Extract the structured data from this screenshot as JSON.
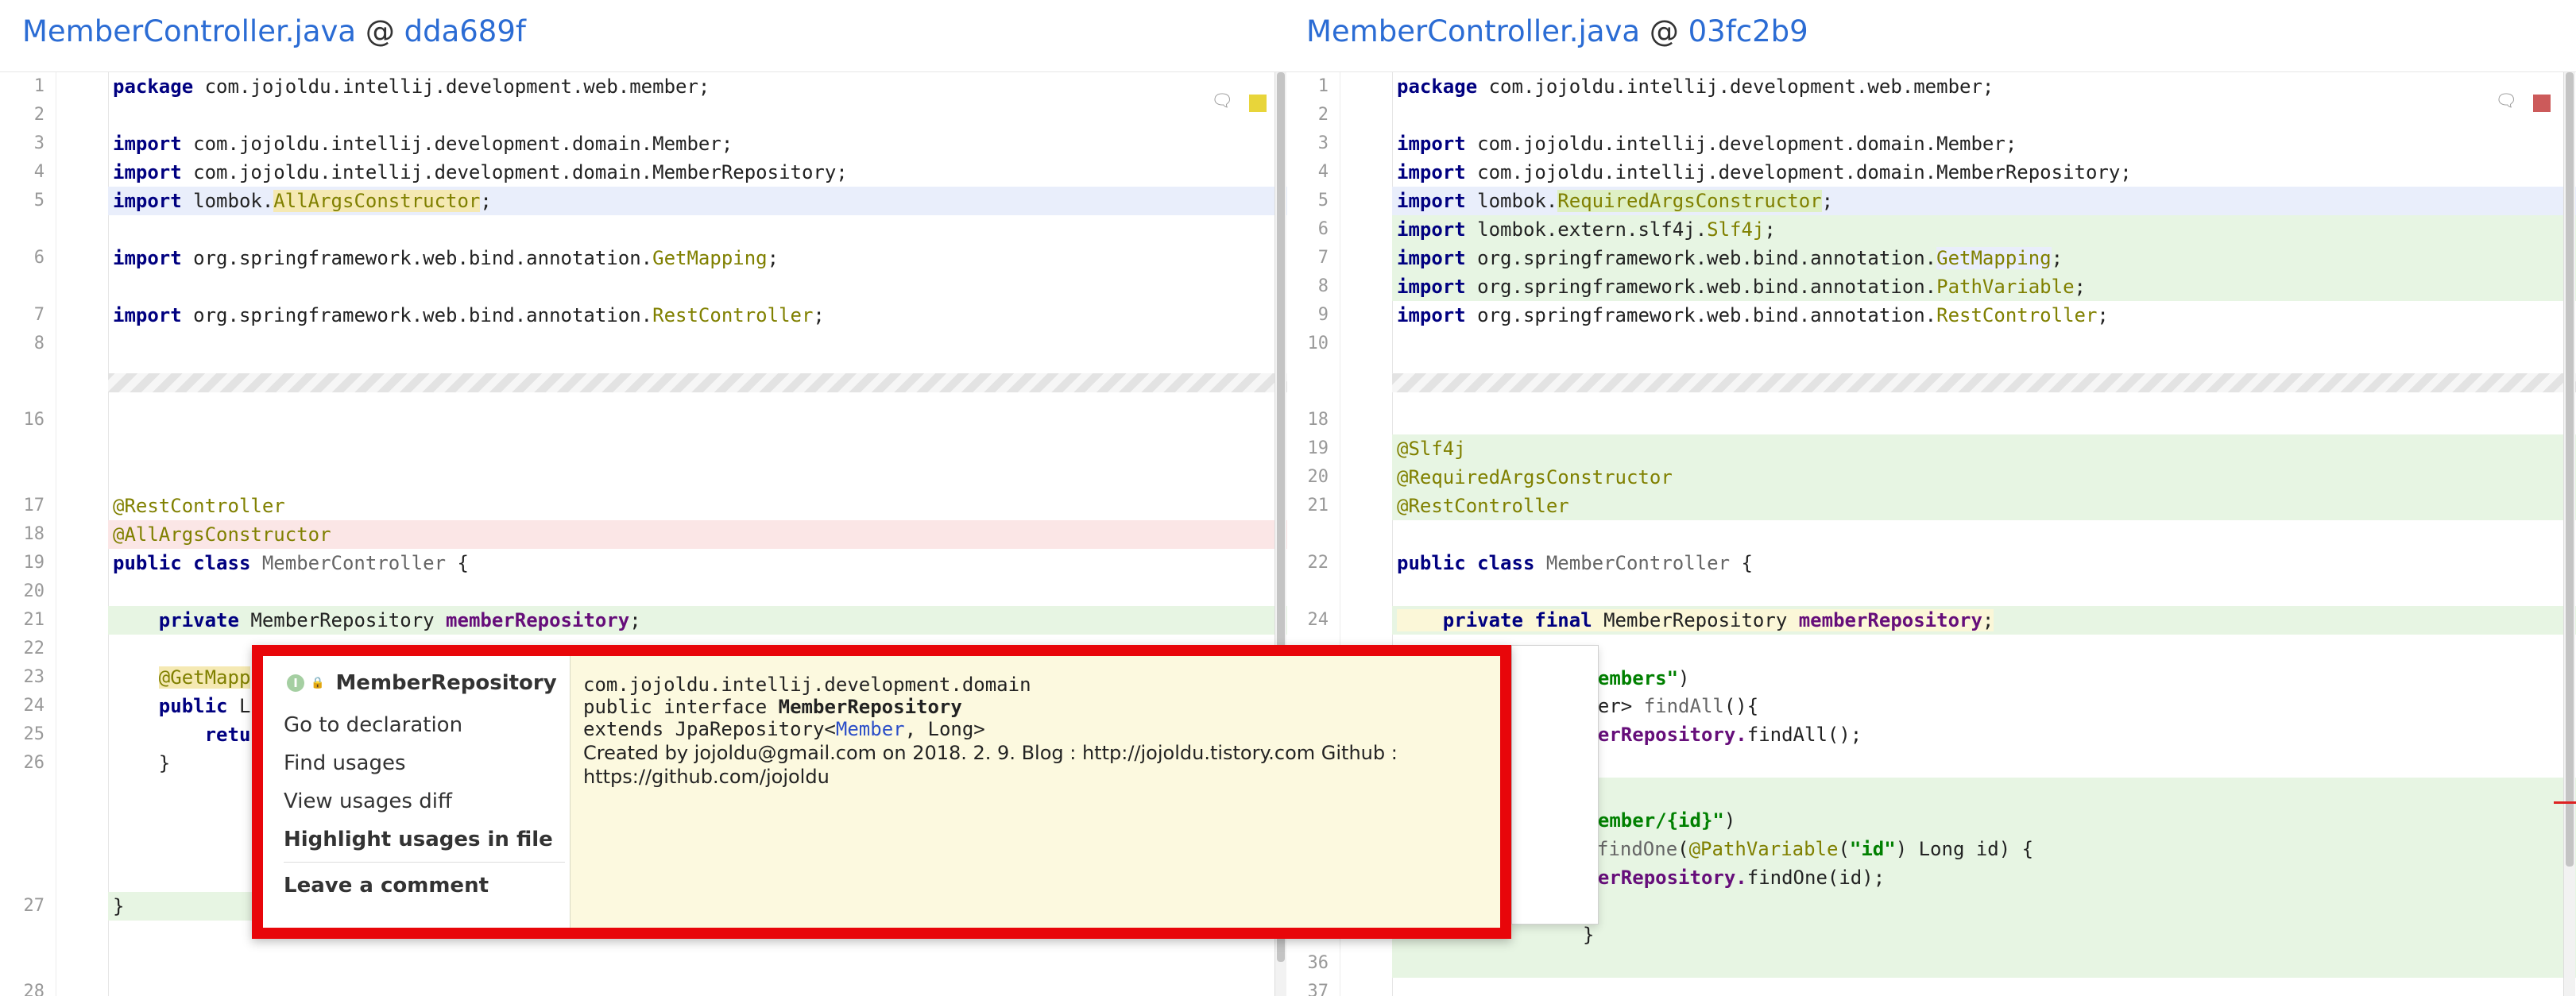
{
  "left": {
    "file": "MemberController.java",
    "at": "@",
    "rev": "dda689f",
    "status_color": "#e8d53a"
  },
  "right": {
    "file": "MemberController.java",
    "at": "@",
    "rev": "03fc2b9",
    "status_color": "#cc5a5a"
  },
  "left_lines": {
    "n1": "1",
    "n2": "2",
    "n3": "3",
    "n4": "4",
    "n5": "5",
    "n6": "6",
    "n7": "7",
    "n8": "8",
    "n16": "16",
    "n17": "17",
    "n18": "18",
    "n19": "19",
    "n20": "20",
    "n21": "21",
    "n22": "22",
    "n23": "23",
    "n24": "24",
    "n25": "25",
    "n26": "26",
    "n27": "27",
    "n28": "28",
    "l1_kw": "package",
    "l1_rest": " com.jojoldu.intellij.development.web.member;",
    "l3_kw": "import",
    "l3_rest": " com.jojoldu.intellij.development.domain.Member;",
    "l4_kw": "import",
    "l4_rest": " com.jojoldu.intellij.development.domain.MemberRepository;",
    "l5_kw": "import",
    "l5_a": " lombok.",
    "l5_tok": "AllArgsConstructor",
    "l5_b": ";",
    "l6_kw": "import",
    "l6_a": " org.springframework.web.bind.annotation.",
    "l6_tok": "GetMapping",
    "l6_b": ";",
    "l7_kw": "import",
    "l7_a": " org.springframework.web.bind.annotation.",
    "l7_tok": "RestController",
    "l7_b": ";",
    "l17": "@RestController",
    "l18": "@AllArgsConstructor",
    "l19_kw": "public class",
    "l19_cls": " MemberController",
    "l19_b": " {",
    "l21_kw": "private",
    "l21_a": " MemberRepository ",
    "l21_fld": "memberRepository",
    "l21_b": ";",
    "l23": "@GetMapp",
    "l24_kw": "public",
    "l24_a": " L",
    "l25_kw": "retu",
    "l26": "}",
    "l27": "}"
  },
  "right_lines": {
    "n1": "1",
    "n2": "2",
    "n3": "3",
    "n4": "4",
    "n5": "5",
    "n6": "6",
    "n7": "7",
    "n8": "8",
    "n9": "9",
    "n10": "10",
    "n18": "18",
    "n19": "19",
    "n20": "20",
    "n21": "21",
    "n22": "22",
    "n24": "24",
    "n36": "36",
    "n37": "37",
    "l1_kw": "package",
    "l1_rest": " com.jojoldu.intellij.development.web.member;",
    "l3_kw": "import",
    "l3_rest": " com.jojoldu.intellij.development.domain.Member;",
    "l4_kw": "import",
    "l4_rest": " com.jojoldu.intellij.development.domain.MemberRepository;",
    "l5_kw": "import",
    "l5_a": " lombok.",
    "l5_tok": "RequiredArgsConstructor",
    "l5_b": ";",
    "l6_kw": "import",
    "l6_a": " lombok.extern.slf4j.",
    "l6_tok": "Slf4j",
    "l6_b": ";",
    "l7_kw": "import",
    "l7_a": " org.springframework.web.bind.annotation.",
    "l7_tok": "GetMapping",
    "l7_b": ";",
    "l8_kw": "import",
    "l8_a": " org.springframework.web.bind.annotation.",
    "l8_tok": "PathVariable",
    "l8_b": ";",
    "l9_kw": "import",
    "l9_a": " org.springframework.web.bind.annotation.",
    "l9_tok": "RestController",
    "l9_b": ";",
    "l19": "@Slf4j",
    "l20": "@RequiredArgsConstructor",
    "l21": "@RestController",
    "l22_kw": "public class",
    "l22_cls": " MemberController",
    "l22_b": " {",
    "l24_kw": "private final",
    "l24_a": " MemberRepository ",
    "l24_fld": "memberRepository",
    "l24_b": ";",
    "p1_str": "/members\"",
    "p1_b": ")",
    "p2": "mber> ",
    "p2_cls": "findAll",
    "p2_b": "(){",
    "p3": "mberRepository.",
    "p3_b": "findAll();",
    "p4_str": "/member/{id}\"",
    "p4_b": ")",
    "p5_cls": "findOne",
    "p5_a": "(",
    "p5_ann": "@PathVariable",
    "p5_b": "(",
    "p5_str": "\"id\"",
    "p5_c": ") Long id) {",
    "p6": "mberRepository.",
    "p6_b": "findOne(id);",
    "p7": "}"
  },
  "popup": {
    "title": "MemberRepository",
    "icon_letter": "I",
    "items": [
      "Go to declaration",
      "Find usages",
      "View usages diff",
      "Highlight usages in file",
      "Leave a comment"
    ],
    "doc_package": "com.jojoldu.intellij.development.domain",
    "doc_decl_a": "public interface ",
    "doc_decl_b": "MemberRepository",
    "doc_ext_a": "extends JpaRepository<",
    "doc_ext_link": "Member",
    "doc_ext_b": ", Long>",
    "doc_author": "Created by jojoldu@gmail.com on 2018. 2. 9. Blog : http://jojoldu.tistory.com Github :",
    "doc_github": "https://github.com/jojoldu"
  },
  "colors": {
    "accent_link": "#2b6cd4",
    "highlight_border": "#e8060a",
    "added_bg": "#e7f5e3",
    "deleted_bg": "#fbe6e6",
    "modified_bg": "#e9eefb"
  },
  "icons": [
    "chat-icon",
    "status-square",
    "interface-icon",
    "lock-icon"
  ]
}
